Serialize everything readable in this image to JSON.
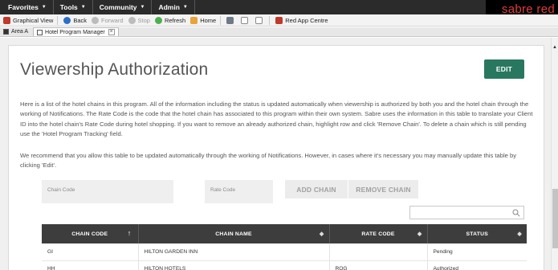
{
  "menubar": {
    "items": [
      {
        "label": "Favorites"
      },
      {
        "label": "Tools"
      },
      {
        "label": "Community"
      },
      {
        "label": "Admin"
      }
    ],
    "brand": "sabre red"
  },
  "toolbar": {
    "graphical_view": "Graphical View",
    "back": "Back",
    "forward": "Forward",
    "stop": "Stop",
    "refresh": "Refresh",
    "home": "Home",
    "red_app_centre": "Red App Centre"
  },
  "tabs": {
    "area_a": "Area A",
    "hotel_program_manager": "Hotel Program Manager"
  },
  "page": {
    "title": "Viewership Authorization",
    "edit_label": "EDIT",
    "paragraph1": "Here is a list of the hotel chains in this program. All of the information including the status is updated automatically when viewership is authorized by both you and the hotel chain through the working of Notifications. The Rate Code is the code that the hotel chain has associated to this program within their own system. Sabre uses the information in this table to translate your Client ID into the hotel chain's Rate Code during hotel shopping. If you want to remove an already authorized chain, highlight row and click 'Remove Chain'. To delete a chain which is still pending use the 'Hotel Program Tracking' field.",
    "paragraph2": "We recommend that you allow this table to be updated automatically through the working of Notifications. However, in cases where it's necessary you may manually update this table by clicking 'Edit'.",
    "chain_code_placeholder": "Chain Code",
    "rate_code_placeholder": "Rate Code",
    "add_chain": "ADD CHAIN",
    "remove_chain": "REMOVE CHAIN"
  },
  "table": {
    "headers": [
      "CHAIN CODE",
      "CHAIN NAME",
      "RATE CODE",
      "STATUS"
    ],
    "rows": [
      [
        "GI",
        "HILTON GARDEN INN",
        "",
        "Pending"
      ],
      [
        "HH",
        "HILTON HOTELS",
        "ROG",
        "Authorized"
      ]
    ]
  },
  "colors": {
    "accent_green": "#287860",
    "brand_red": "#e13b3b",
    "header_dark": "#3d3d3d"
  }
}
